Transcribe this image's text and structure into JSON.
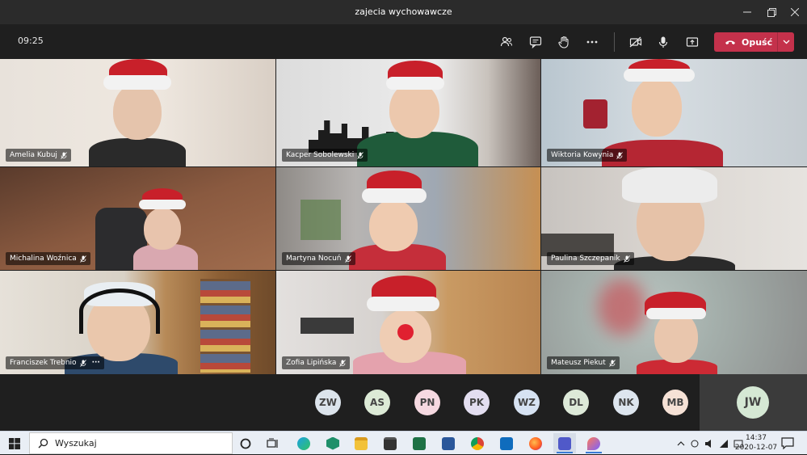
{
  "window": {
    "title": "zajecia wychowawcze"
  },
  "toolbar": {
    "timer": "09:25",
    "leave_label": "Opuść"
  },
  "participants": [
    {
      "name": "Amelia Kubuj"
    },
    {
      "name": "Kacper Sobolewski"
    },
    {
      "name": "Wiktoria Kowynia"
    },
    {
      "name": "Michalina Woźnica"
    },
    {
      "name": "Martyna Nocuń"
    },
    {
      "name": "Paulina Szczepanik"
    },
    {
      "name": "Franciszek Trebnio"
    },
    {
      "name": "Zofia Lipińska"
    },
    {
      "name": "Mateusz Piekut"
    }
  ],
  "more_options_glyph": "···",
  "avatars": [
    "ZW",
    "AS",
    "PN",
    "PK",
    "WZ",
    "DL",
    "NK",
    "MB"
  ],
  "self_avatar": "JW",
  "taskbar": {
    "search_placeholder": "Wyszukaj",
    "time": "14:37",
    "date": "2020-12-07"
  },
  "colors": {
    "leave_button": "#c4314b",
    "toolbar_bg": "#1f1f1f",
    "santa_hat": "#c8202a"
  },
  "icons": [
    "people-icon",
    "chat-icon",
    "raise-hand-icon",
    "more-icon",
    "camera-off-icon",
    "microphone-icon",
    "share-screen-icon",
    "phone-hangup-icon",
    "chevron-down-icon",
    "windows-start-icon",
    "search-icon",
    "mic-off-icon"
  ]
}
